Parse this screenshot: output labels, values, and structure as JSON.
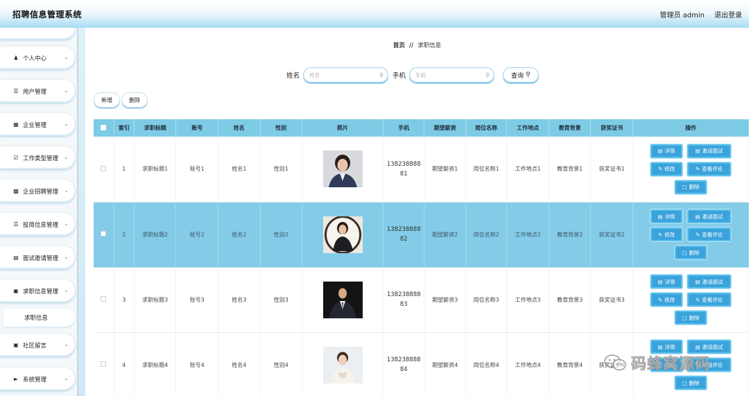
{
  "app": {
    "title": "招聘信息管理系统"
  },
  "header": {
    "admin_label": "管理员 admin",
    "logout_label": "退出登录"
  },
  "sidebar": {
    "items": [
      {
        "label": "个人中心",
        "icon": "user-icon"
      },
      {
        "label": "用户管理",
        "icon": "list-icon"
      },
      {
        "label": "企业管理",
        "icon": "grid-icon"
      },
      {
        "label": "工作类型管理",
        "icon": "checkbox-icon"
      },
      {
        "label": "企业招聘管理",
        "icon": "folder-icon"
      },
      {
        "label": "投简信息管理",
        "icon": "list-icon"
      },
      {
        "label": "面试邀请管理",
        "icon": "document-icon"
      },
      {
        "label": "求职信息管理",
        "icon": "apps-icon"
      },
      {
        "label": "社区留言",
        "icon": "apps-icon"
      },
      {
        "label": "系统管理",
        "icon": "video-icon"
      }
    ],
    "submenu": {
      "label": "求职信息"
    }
  },
  "breadcrumb": {
    "home": "首页",
    "separator": "//",
    "current": "求职信息"
  },
  "search": {
    "name_label": "姓名",
    "name_placeholder": "姓名",
    "phone_label": "手机",
    "phone_placeholder": "手机",
    "query_label": "查询"
  },
  "actions": {
    "add_label": "新增",
    "delete_label": "删除"
  },
  "table": {
    "columns": [
      "索引",
      "求职标题",
      "账号",
      "姓名",
      "性别",
      "照片",
      "手机",
      "期望薪资",
      "岗位名称",
      "工作地点",
      "教育背景",
      "获奖证书",
      "操作"
    ],
    "rows": [
      {
        "index": "1",
        "title": "求职标题1",
        "account": "账号1",
        "name": "姓名1",
        "gender": "性别1",
        "phone_a": "138238888",
        "phone_b": "81",
        "salary": "期望薪资1",
        "position": "岗位名称1",
        "location": "工作地点1",
        "education": "教育背景1",
        "award": "获奖证书1"
      },
      {
        "index": "2",
        "title": "求职标题2",
        "account": "账号2",
        "name": "姓名2",
        "gender": "性别2",
        "phone_a": "138238888",
        "phone_b": "82",
        "salary": "期望薪资2",
        "position": "岗位名称2",
        "location": "工作地点2",
        "education": "教育背景2",
        "award": "获奖证书2"
      },
      {
        "index": "3",
        "title": "求职标题3",
        "account": "账号3",
        "name": "姓名3",
        "gender": "性别3",
        "phone_a": "138238888",
        "phone_b": "83",
        "salary": "期望薪资3",
        "position": "岗位名称3",
        "location": "工作地点3",
        "education": "教育背景3",
        "award": "获奖证书3"
      },
      {
        "index": "4",
        "title": "求职标题4",
        "account": "账号4",
        "name": "姓名4",
        "gender": "性别4",
        "phone_a": "138238888",
        "phone_b": "84",
        "salary": "期望薪资4",
        "position": "岗位名称4",
        "location": "工作地点4",
        "education": "教育背景4",
        "award": "获奖证书4"
      }
    ],
    "row_ops": {
      "detail": "详情",
      "invite": "邀请面试",
      "edit": "修改",
      "review": "查看评论",
      "delete": "删除"
    }
  },
  "watermark": {
    "text": "码蜂窝源码"
  },
  "colors": {
    "header_row": "#7ecbe6",
    "highlight_row": "#84cbe8",
    "op_button": "#3aa3dc"
  }
}
